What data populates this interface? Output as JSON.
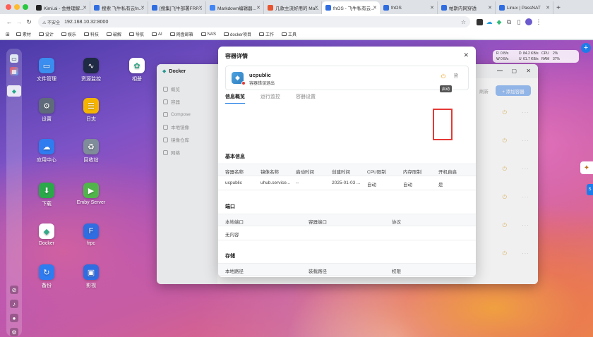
{
  "browser": {
    "tabs": [
      {
        "label": "Kimi.ai - 会推理解...",
        "color": "#222"
      },
      {
        "label": "搜索 飞牛私有云fn...",
        "color": "#2f6de1"
      },
      {
        "label": "[搜集]飞牛部署FRP...",
        "color": "#2f6de1"
      },
      {
        "label": "Markdown编辑器...",
        "color": "#4285f4"
      },
      {
        "label": "几款主流好用的 Ma...",
        "color": "#e8542f"
      },
      {
        "label": "fnOS - 飞牛私有云...",
        "color": "#2f6de1"
      },
      {
        "label": "fnOS",
        "color": "#2f6de1"
      },
      {
        "label": "帕斯内网穿透",
        "color": "#2f6de1"
      },
      {
        "label": "Linux | PassNAT",
        "color": "#2f6de1"
      }
    ],
    "active_tab": 5,
    "new_tab": "+",
    "url": "192.168.10.32:8000",
    "security_label": "不安全",
    "bookmarks": [
      "素材",
      "设计",
      "娱乐",
      "科技",
      "破解",
      "导航",
      "AI",
      "网盘邮箱",
      "NAS",
      "docker项目",
      "工作",
      "工具"
    ]
  },
  "desktop": {
    "apps": [
      {
        "label": "文件管理",
        "icon": "folder-icon",
        "glyph": "▭",
        "bg": "#3a8ef0"
      },
      {
        "label": "资源监控",
        "icon": "monitor-icon",
        "glyph": "∿",
        "bg": "#1f2a44"
      },
      {
        "label": "相册",
        "icon": "photos-icon",
        "glyph": "✿",
        "bg": "#ffffff"
      },
      {
        "label": "设置",
        "icon": "gear-icon",
        "glyph": "⚙",
        "bg": "#5f6b7a"
      },
      {
        "label": "日志",
        "icon": "log-icon",
        "glyph": "☰",
        "bg": "#f4b400"
      },
      {
        "label": "应用中心",
        "icon": "app-center-icon",
        "glyph": "☁",
        "bg": "#2f7cf0"
      },
      {
        "label": "回收站",
        "icon": "recycle-icon",
        "glyph": "♻",
        "bg": "#7f8c99"
      },
      {
        "label": "下载",
        "icon": "download-icon",
        "glyph": "⬇",
        "bg": "#2ba84a"
      },
      {
        "label": "Emby Server",
        "icon": "emby-icon",
        "glyph": "▶",
        "bg": "#52b54b"
      },
      {
        "label": "Docker",
        "icon": "docker-icon",
        "glyph": "◆",
        "bg": "#ffffff"
      },
      {
        "label": "frpc",
        "icon": "frpc-icon",
        "glyph": "F",
        "bg": "#2f6de1"
      },
      {
        "label": "备份",
        "icon": "backup-icon",
        "glyph": "↻",
        "bg": "#2f7cf0"
      },
      {
        "label": "影视",
        "icon": "video-icon",
        "glyph": "▣",
        "bg": "#2f6de1"
      }
    ],
    "net": {
      "r1": [
        "R",
        "0 B/s",
        "D",
        "84.2 KB/s",
        "CPU",
        "2%"
      ],
      "r2": [
        "W",
        "0 B/s",
        "U",
        "61.7 KB/s",
        "RAM",
        "37%"
      ]
    }
  },
  "docker": {
    "title": "Docker",
    "nav": [
      "概览",
      "容器",
      "Compose",
      "本地镜像",
      "镜像仓库",
      "网络"
    ],
    "refresh_label": "刷新",
    "add_label": "+ 添加容器"
  },
  "modal": {
    "title": "容器详情",
    "container": {
      "name": "ucpublic",
      "status": "容器错误退出",
      "tooltip": "启动"
    },
    "tabs": [
      "信息概览",
      "运行监控",
      "容器设置"
    ],
    "basic": {
      "heading": "基本信息",
      "headers": [
        "容器名称",
        "镜像名称",
        "启动时间",
        "创建时间",
        "CPU限制",
        "内存限制",
        "开机自启"
      ],
      "values": [
        "ucpublic",
        "uhub.service...",
        "--",
        "2025-01-03 ...",
        "自动",
        "自动",
        "是"
      ]
    },
    "ports": {
      "heading": "端口",
      "headers": [
        "本地端口",
        "容器端口",
        "协议"
      ],
      "empty": "无内容"
    },
    "storage": {
      "heading": "存储",
      "headers": [
        "本地路径",
        "装载路径",
        "权限"
      ]
    }
  }
}
